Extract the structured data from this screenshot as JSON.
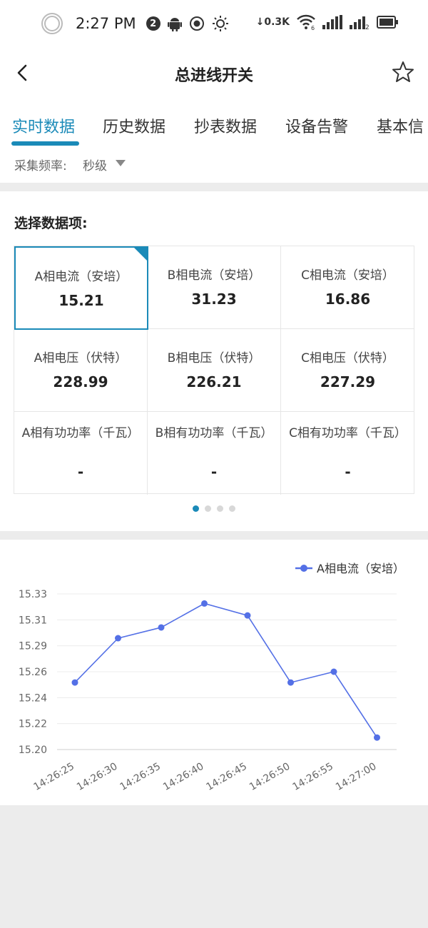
{
  "status_bar": {
    "time": "2:27 PM",
    "notification_count": "2",
    "net_speed": "0.3K",
    "wifi_sub": "6",
    "sim_sub": "2"
  },
  "header": {
    "title": "总进线开关"
  },
  "tabs": [
    {
      "label": "实时数据",
      "active": true
    },
    {
      "label": "历史数据",
      "active": false
    },
    {
      "label": "抄表数据",
      "active": false
    },
    {
      "label": "设备告警",
      "active": false
    },
    {
      "label": "基本信",
      "active": false
    }
  ],
  "frequency": {
    "label": "采集频率:",
    "value": "秒级"
  },
  "data_items": {
    "title": "选择数据项:",
    "cells": [
      {
        "label": "A相电流（安培）",
        "value": "15.21",
        "selected": true
      },
      {
        "label": "B相电流（安培）",
        "value": "31.23",
        "selected": false
      },
      {
        "label": "C相电流（安培）",
        "value": "16.86",
        "selected": false
      },
      {
        "label": "A相电压（伏特）",
        "value": "228.99",
        "selected": false
      },
      {
        "label": "B相电压（伏特）",
        "value": "226.21",
        "selected": false
      },
      {
        "label": "C相电压（伏特）",
        "value": "227.29",
        "selected": false
      },
      {
        "label": "A相有功功率（千瓦）",
        "value": "-",
        "selected": false
      },
      {
        "label": "B相有功功率（千瓦）",
        "value": "-",
        "selected": false
      },
      {
        "label": "C相有功功率（千瓦）",
        "value": "-",
        "selected": false
      }
    ],
    "page_count": 4,
    "current_page": 0
  },
  "colors": {
    "accent": "#1a8ab8",
    "series": "#5470e6"
  },
  "chart_data": {
    "type": "line",
    "title": "",
    "xlabel": "",
    "ylabel": "",
    "legend": "top-right",
    "grid": true,
    "x": [
      "14:26:25",
      "14:26:30",
      "14:26:35",
      "14:26:40",
      "14:26:45",
      "14:26:50",
      "14:26:55",
      "14:27:00"
    ],
    "y_ticks": [
      "15.20",
      "15.22",
      "15.24",
      "15.26",
      "15.29",
      "15.31",
      "15.33"
    ],
    "ylim": [
      15.2,
      15.33
    ],
    "series": [
      {
        "name": "A相电流（安培）",
        "values": [
          15.256,
          15.293,
          15.302,
          15.322,
          15.312,
          15.256,
          15.265,
          15.21
        ]
      }
    ]
  }
}
